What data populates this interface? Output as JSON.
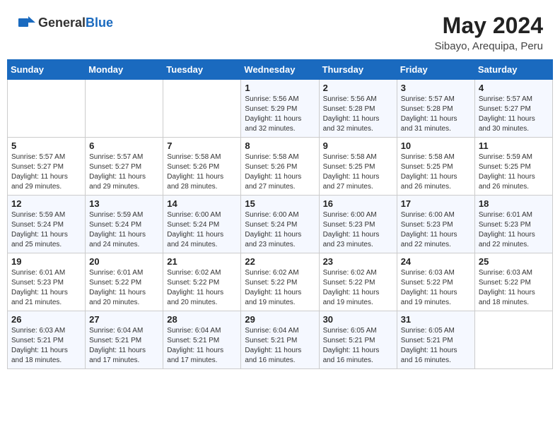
{
  "header": {
    "logo_general": "General",
    "logo_blue": "Blue",
    "month_year": "May 2024",
    "location": "Sibayo, Arequipa, Peru"
  },
  "days_of_week": [
    "Sunday",
    "Monday",
    "Tuesday",
    "Wednesday",
    "Thursday",
    "Friday",
    "Saturday"
  ],
  "weeks": [
    [
      {
        "day": "",
        "info": ""
      },
      {
        "day": "",
        "info": ""
      },
      {
        "day": "",
        "info": ""
      },
      {
        "day": "1",
        "info": "Sunrise: 5:56 AM\nSunset: 5:29 PM\nDaylight: 11 hours and 32 minutes."
      },
      {
        "day": "2",
        "info": "Sunrise: 5:56 AM\nSunset: 5:28 PM\nDaylight: 11 hours and 32 minutes."
      },
      {
        "day": "3",
        "info": "Sunrise: 5:57 AM\nSunset: 5:28 PM\nDaylight: 11 hours and 31 minutes."
      },
      {
        "day": "4",
        "info": "Sunrise: 5:57 AM\nSunset: 5:27 PM\nDaylight: 11 hours and 30 minutes."
      }
    ],
    [
      {
        "day": "5",
        "info": "Sunrise: 5:57 AM\nSunset: 5:27 PM\nDaylight: 11 hours and 29 minutes."
      },
      {
        "day": "6",
        "info": "Sunrise: 5:57 AM\nSunset: 5:27 PM\nDaylight: 11 hours and 29 minutes."
      },
      {
        "day": "7",
        "info": "Sunrise: 5:58 AM\nSunset: 5:26 PM\nDaylight: 11 hours and 28 minutes."
      },
      {
        "day": "8",
        "info": "Sunrise: 5:58 AM\nSunset: 5:26 PM\nDaylight: 11 hours and 27 minutes."
      },
      {
        "day": "9",
        "info": "Sunrise: 5:58 AM\nSunset: 5:25 PM\nDaylight: 11 hours and 27 minutes."
      },
      {
        "day": "10",
        "info": "Sunrise: 5:58 AM\nSunset: 5:25 PM\nDaylight: 11 hours and 26 minutes."
      },
      {
        "day": "11",
        "info": "Sunrise: 5:59 AM\nSunset: 5:25 PM\nDaylight: 11 hours and 26 minutes."
      }
    ],
    [
      {
        "day": "12",
        "info": "Sunrise: 5:59 AM\nSunset: 5:24 PM\nDaylight: 11 hours and 25 minutes."
      },
      {
        "day": "13",
        "info": "Sunrise: 5:59 AM\nSunset: 5:24 PM\nDaylight: 11 hours and 24 minutes."
      },
      {
        "day": "14",
        "info": "Sunrise: 6:00 AM\nSunset: 5:24 PM\nDaylight: 11 hours and 24 minutes."
      },
      {
        "day": "15",
        "info": "Sunrise: 6:00 AM\nSunset: 5:24 PM\nDaylight: 11 hours and 23 minutes."
      },
      {
        "day": "16",
        "info": "Sunrise: 6:00 AM\nSunset: 5:23 PM\nDaylight: 11 hours and 23 minutes."
      },
      {
        "day": "17",
        "info": "Sunrise: 6:00 AM\nSunset: 5:23 PM\nDaylight: 11 hours and 22 minutes."
      },
      {
        "day": "18",
        "info": "Sunrise: 6:01 AM\nSunset: 5:23 PM\nDaylight: 11 hours and 22 minutes."
      }
    ],
    [
      {
        "day": "19",
        "info": "Sunrise: 6:01 AM\nSunset: 5:23 PM\nDaylight: 11 hours and 21 minutes."
      },
      {
        "day": "20",
        "info": "Sunrise: 6:01 AM\nSunset: 5:22 PM\nDaylight: 11 hours and 20 minutes."
      },
      {
        "day": "21",
        "info": "Sunrise: 6:02 AM\nSunset: 5:22 PM\nDaylight: 11 hours and 20 minutes."
      },
      {
        "day": "22",
        "info": "Sunrise: 6:02 AM\nSunset: 5:22 PM\nDaylight: 11 hours and 19 minutes."
      },
      {
        "day": "23",
        "info": "Sunrise: 6:02 AM\nSunset: 5:22 PM\nDaylight: 11 hours and 19 minutes."
      },
      {
        "day": "24",
        "info": "Sunrise: 6:03 AM\nSunset: 5:22 PM\nDaylight: 11 hours and 19 minutes."
      },
      {
        "day": "25",
        "info": "Sunrise: 6:03 AM\nSunset: 5:22 PM\nDaylight: 11 hours and 18 minutes."
      }
    ],
    [
      {
        "day": "26",
        "info": "Sunrise: 6:03 AM\nSunset: 5:21 PM\nDaylight: 11 hours and 18 minutes."
      },
      {
        "day": "27",
        "info": "Sunrise: 6:04 AM\nSunset: 5:21 PM\nDaylight: 11 hours and 17 minutes."
      },
      {
        "day": "28",
        "info": "Sunrise: 6:04 AM\nSunset: 5:21 PM\nDaylight: 11 hours and 17 minutes."
      },
      {
        "day": "29",
        "info": "Sunrise: 6:04 AM\nSunset: 5:21 PM\nDaylight: 11 hours and 16 minutes."
      },
      {
        "day": "30",
        "info": "Sunrise: 6:05 AM\nSunset: 5:21 PM\nDaylight: 11 hours and 16 minutes."
      },
      {
        "day": "31",
        "info": "Sunrise: 6:05 AM\nSunset: 5:21 PM\nDaylight: 11 hours and 16 minutes."
      },
      {
        "day": "",
        "info": ""
      }
    ]
  ]
}
